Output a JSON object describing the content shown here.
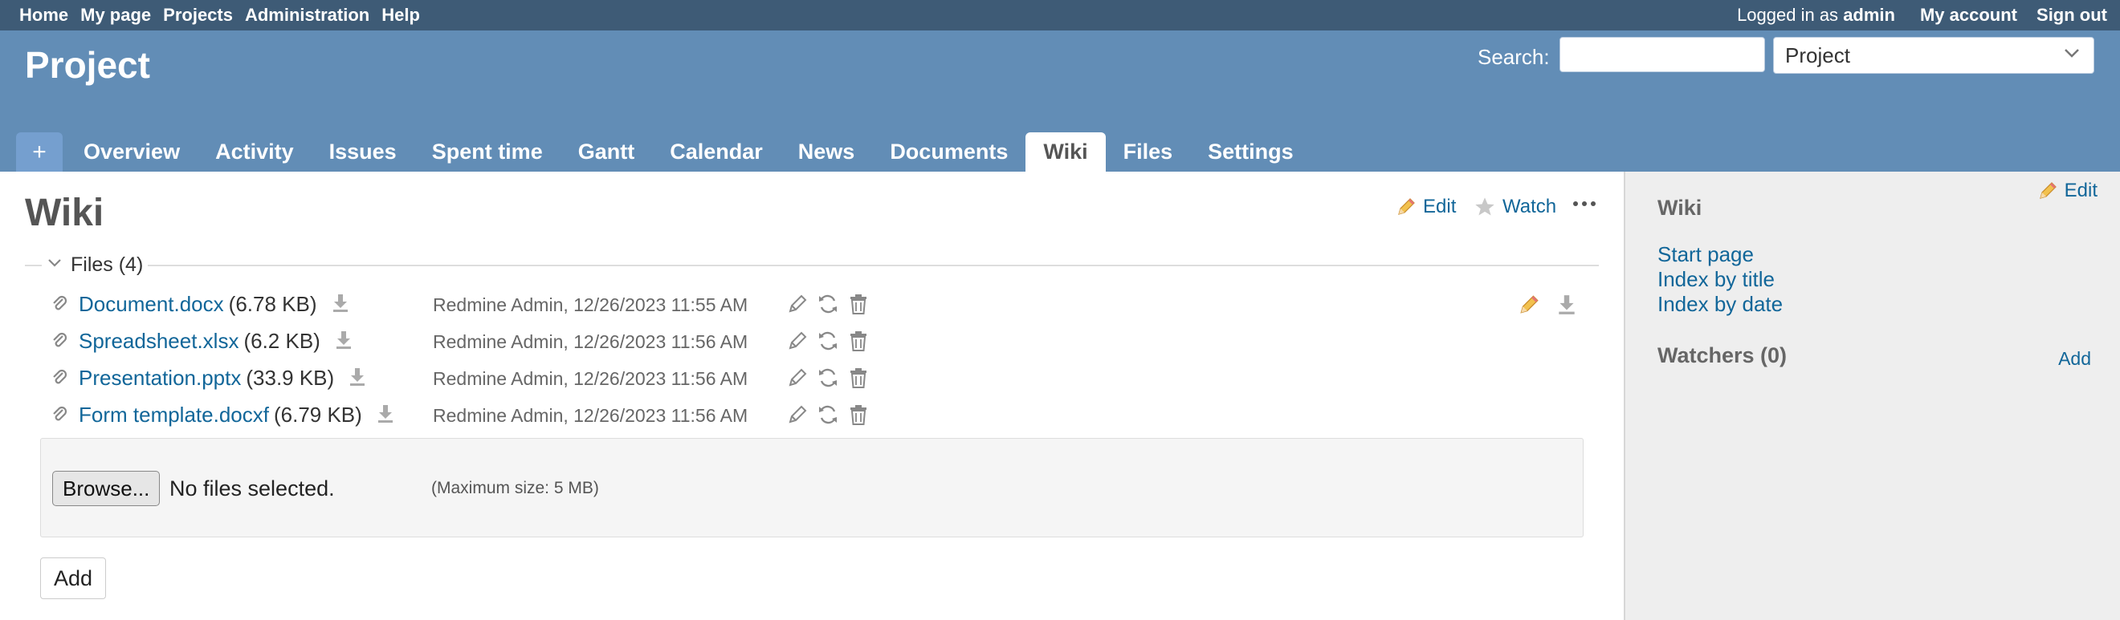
{
  "top_menu": {
    "items": [
      "Home",
      "My page",
      "Projects",
      "Administration",
      "Help"
    ],
    "logged_in_prefix": "Logged in as",
    "logged_in_user": "admin",
    "my_account": "My account",
    "sign_out": "Sign out"
  },
  "header": {
    "project_title": "Project",
    "search_label": "Search:",
    "search_value": "",
    "scope_selected": "Project"
  },
  "tabs": {
    "plus": "+",
    "items": [
      "Overview",
      "Activity",
      "Issues",
      "Spent time",
      "Gantt",
      "Calendar",
      "News",
      "Documents",
      "Wiki",
      "Files",
      "Settings"
    ],
    "selected": "Wiki"
  },
  "content": {
    "title": "Wiki",
    "edit_label": "Edit",
    "watch_label": "Watch",
    "more_label": "...",
    "files_legend": "Files (4)",
    "attachments": [
      {
        "name": "Document.docx",
        "size": "(6.78 KB)",
        "author": "Redmine Admin, 12/26/2023 11:55 AM"
      },
      {
        "name": "Spreadsheet.xlsx",
        "size": "(6.2 KB)",
        "author": "Redmine Admin, 12/26/2023 11:56 AM"
      },
      {
        "name": "Presentation.pptx",
        "size": "(33.9 KB)",
        "author": "Redmine Admin, 12/26/2023 11:56 AM"
      },
      {
        "name": "Form template.docxf",
        "size": "(6.79 KB)",
        "author": "Redmine Admin, 12/26/2023 11:56 AM"
      }
    ],
    "browse_label": "Browse...",
    "no_files": "No files selected.",
    "max_size": "(Maximum size: 5 MB)",
    "add_label": "Add"
  },
  "sidebar": {
    "edit_label": "Edit",
    "title": "Wiki",
    "links": [
      "Start page",
      "Index by title",
      "Index by date"
    ],
    "watchers": "Watchers (0)",
    "add_label": "Add"
  },
  "colors": {
    "top_bar": "#3e5b76",
    "header": "#628db6",
    "link": "#169",
    "sidebar_bg": "#eeeeee"
  }
}
